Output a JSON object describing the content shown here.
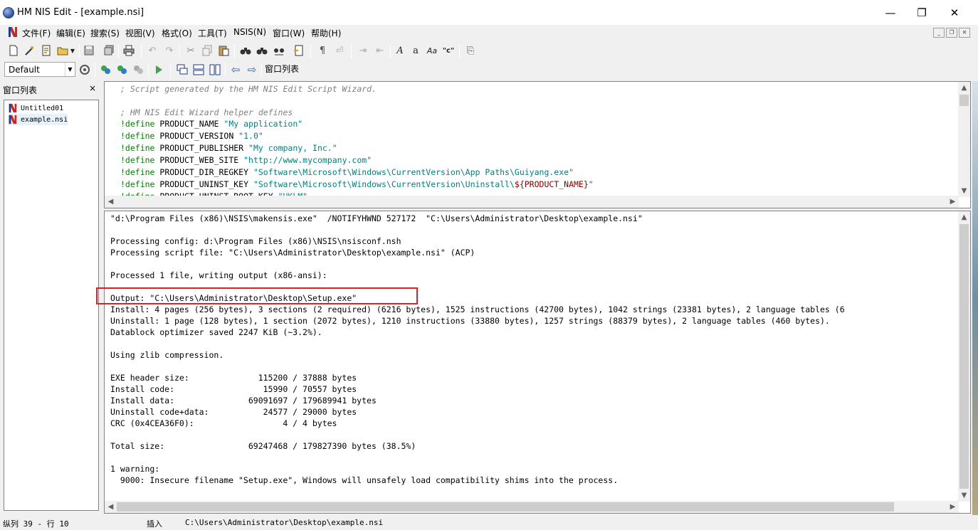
{
  "window": {
    "title": "HM NIS Edit - [example.nsi]",
    "minimize": "—",
    "maximize": "❐",
    "close": "✕"
  },
  "menu": [
    "文件(F)",
    "编辑(E)",
    "搜索(S)",
    "视图(V)",
    "格式(O)",
    "工具(T)",
    "NSIS(N)",
    "窗口(W)",
    "帮助(H)"
  ],
  "toolbar": {
    "config_combo": "Default",
    "window_list_button": "窗口列表"
  },
  "sidebar": {
    "title": "窗口列表",
    "close": "×",
    "items": [
      {
        "label": "Untitled01"
      },
      {
        "label": "example.nsi"
      }
    ]
  },
  "editor": {
    "lines": [
      {
        "comment": "; Script generated by the HM NIS Edit Script Wizard."
      },
      {
        "comment": ""
      },
      {
        "comment": "; HM NIS Edit Wizard helper defines"
      },
      {
        "kw": "!define",
        "name": " PRODUCT_NAME ",
        "str": "\"My application\""
      },
      {
        "kw": "!define",
        "name": " PRODUCT_VERSION ",
        "str": "\"1.0\""
      },
      {
        "kw": "!define",
        "name": " PRODUCT_PUBLISHER ",
        "str": "\"My company, Inc.\""
      },
      {
        "kw": "!define",
        "name": " PRODUCT_WEB_SITE ",
        "str": "\"http://www.mycompany.com\""
      },
      {
        "kw": "!define",
        "name": " PRODUCT_DIR_REGKEY ",
        "str": "\"Software\\Microsoft\\Windows\\CurrentVersion\\App Paths\\Guiyang.exe\""
      },
      {
        "kw": "!define",
        "name": " PRODUCT_UNINST_KEY ",
        "str": "\"Software\\Microsoft\\Windows\\CurrentVersion\\Uninstall\\",
        "var": "${PRODUCT_NAME}",
        "str2": "\""
      },
      {
        "kw": "!define",
        "name": " PRODUCT_UNINST_ROOT_KEY ",
        "str": "\"HKLM\""
      }
    ]
  },
  "output": {
    "lines": [
      "\"d:\\Program Files (x86)\\NSIS\\makensis.exe\"  /NOTIFYHWND 527172  \"C:\\Users\\Administrator\\Desktop\\example.nsi\"",
      "",
      "Processing config: d:\\Program Files (x86)\\NSIS\\nsisconf.nsh",
      "Processing script file: \"C:\\Users\\Administrator\\Desktop\\example.nsi\" (ACP)",
      "",
      "Processed 1 file, writing output (x86-ansi):",
      "",
      "Output: \"C:\\Users\\Administrator\\Desktop\\Setup.exe\"",
      "Install: 4 pages (256 bytes), 3 sections (2 required) (6216 bytes), 1525 instructions (42700 bytes), 1042 strings (23381 bytes), 2 language tables (6",
      "Uninstall: 1 page (128 bytes), 1 section (2072 bytes), 1210 instructions (33880 bytes), 1257 strings (88379 bytes), 2 language tables (460 bytes).",
      "Datablock optimizer saved 2247 KiB (~3.2%).",
      "",
      "Using zlib compression.",
      "",
      "EXE header size:              115200 / 37888 bytes",
      "Install code:                  15990 / 70557 bytes",
      "Install data:               69091697 / 179689941 bytes",
      "Uninstall code+data:           24577 / 29000 bytes",
      "CRC (0x4CEA36F0):                  4 / 4 bytes",
      "",
      "Total size:                 69247468 / 179827390 bytes (38.5%)",
      "",
      "1 warning:",
      "  9000: Insecure filename \"Setup.exe\", Windows will unsafely load compatibility shims into the process."
    ]
  },
  "status": {
    "position": "纵列 39 - 行 10",
    "mode": "插入",
    "path": "C:\\Users\\Administrator\\Desktop\\example.nsi"
  }
}
